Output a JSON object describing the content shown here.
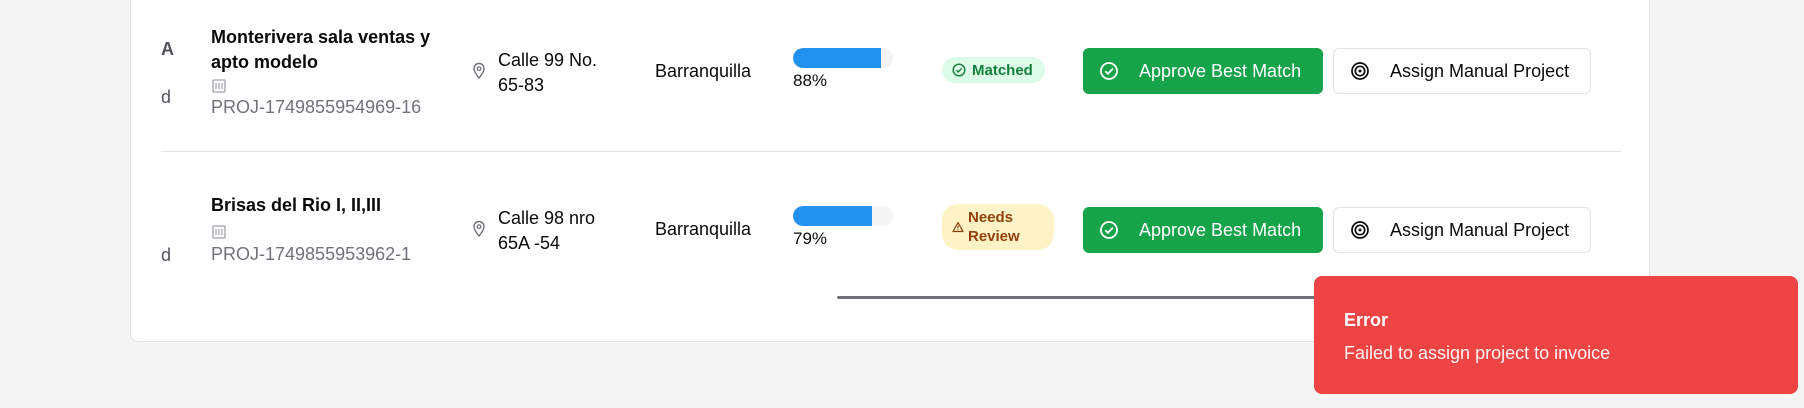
{
  "rows": [
    {
      "clip_text": "A",
      "clip_text_2": "d",
      "name": "Monterivera sala ventas y apto modelo",
      "project_id": "PROJ-1749855954969-16",
      "address": "Calle 99 No. 65-83",
      "city": "Barranquilla",
      "match_percent_label": "88%",
      "match_fraction": 0.88,
      "status": "Matched",
      "status_icon": "check-circle-icon",
      "approve_label": "Approve Best Match",
      "assign_label": "Assign Manual Project"
    },
    {
      "clip_text": "d",
      "name": "Brisas del Rio I, II,III",
      "project_id": "PROJ-1749855953962-1",
      "address": "Calle 98 nro 65A -54",
      "city": "Barranquilla",
      "match_percent_label": "79%",
      "match_fraction": 0.79,
      "status": "Needs Review",
      "status_icon": "warning-triangle-icon",
      "approve_label": "Approve Best Match",
      "assign_label": "Assign Manual Project"
    }
  ],
  "toast": {
    "title": "Error",
    "message": "Failed to assign project to invoice"
  },
  "colors": {
    "approve": "#16a34a",
    "progress": "#2291f0",
    "matched_bg": "#dcfce7",
    "review_bg": "#fef3c7",
    "toast": "#ef4444"
  }
}
